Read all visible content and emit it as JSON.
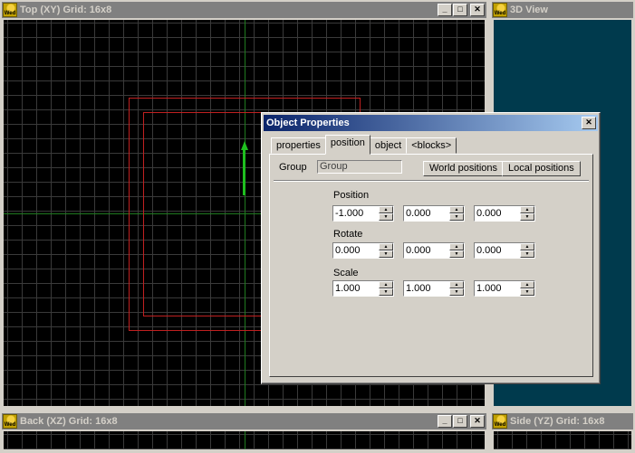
{
  "windows": {
    "top": {
      "title": "Top (XY) Grid: 16x8"
    },
    "view3d": {
      "title": "3D View"
    },
    "back": {
      "title": "Back (XZ) Grid: 16x8"
    },
    "side": {
      "title": "Side (YZ) Grid: 16x8"
    }
  },
  "controls": {
    "minimize": "_",
    "maximize": "□",
    "close": "✕"
  },
  "app_icon_label": "Wed",
  "dialog": {
    "title": "Object Properties",
    "close": "✕",
    "tabs": [
      "properties",
      "position",
      "object",
      "<blocks>"
    ],
    "active_tab": "position",
    "group_label": "Group",
    "group_value": "Group",
    "world_button": "World positions",
    "local_button": "Local positions",
    "sections": [
      {
        "label": "Position",
        "values": [
          "-1.000",
          "0.000",
          "0.000"
        ]
      },
      {
        "label": "Rotate",
        "values": [
          "0.000",
          "0.000",
          "0.000"
        ]
      },
      {
        "label": "Scale",
        "values": [
          "1.000",
          "1.000",
          "1.000"
        ]
      }
    ]
  },
  "colors": {
    "viewport_bg": "#000000",
    "view3d_bg": "#003a4d",
    "inactive_title": "#808080",
    "active_title": "#0a246a",
    "selection_red": "#c02020",
    "axis_green": "#1fbf1f"
  },
  "icons": {
    "app": "wed-app-icon",
    "spin_up": "spin-up-icon",
    "spin_down": "spin-down-icon"
  }
}
